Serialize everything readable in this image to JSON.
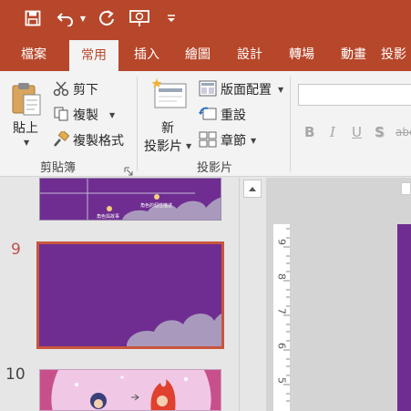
{
  "quick_access": {
    "icons": [
      "save-icon",
      "undo-icon",
      "redo-icon",
      "slideshow-from-start-icon",
      "customize-toolbar-icon"
    ]
  },
  "tabs": [
    {
      "label": "檔案",
      "active": false
    },
    {
      "label": "常用",
      "active": true
    },
    {
      "label": "插入",
      "active": false
    },
    {
      "label": "繪圖",
      "active": false
    },
    {
      "label": "設計",
      "active": false
    },
    {
      "label": "轉場",
      "active": false
    },
    {
      "label": "動畫",
      "active": false
    },
    {
      "label": "投影",
      "active": false
    }
  ],
  "clipboard": {
    "paste_label": "貼上",
    "cut_label": "剪下",
    "copy_label": "複製",
    "format_painter_label": "複製格式",
    "group_label": "剪貼簿"
  },
  "slides_group": {
    "new_slide_line1": "新",
    "new_slide_line2": "投影片",
    "layout_label": "版面配置",
    "reset_label": "重設",
    "section_label": "章節",
    "group_label": "投影片"
  },
  "font": {
    "font_name_value": "",
    "bold": "B",
    "italic": "I",
    "underline": "U",
    "shadow": "S",
    "strikethrough": "abc"
  },
  "thumbnails": [
    {
      "number": "",
      "caption": "角色與故事",
      "sub": "角色的個性描述"
    },
    {
      "number": "9",
      "selected": true
    },
    {
      "number": "10"
    }
  ],
  "ruler_numbers": [
    "9",
    "8",
    "7",
    "6",
    "5"
  ],
  "colors": {
    "accent": "#b7472a",
    "slide_purple": "#6f2d91",
    "cloud": "#a99abd",
    "selection": "#c8553d"
  }
}
